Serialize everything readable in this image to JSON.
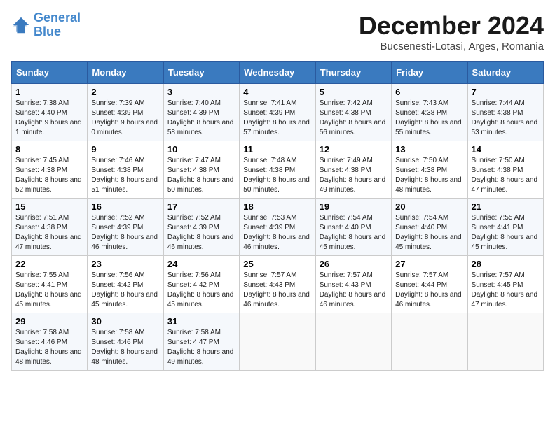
{
  "logo": {
    "text1": "General",
    "text2": "Blue"
  },
  "title": "December 2024",
  "subtitle": "Bucsenesti-Lotasi, Arges, Romania",
  "days_of_week": [
    "Sunday",
    "Monday",
    "Tuesday",
    "Wednesday",
    "Thursday",
    "Friday",
    "Saturday"
  ],
  "weeks": [
    [
      {
        "day": "1",
        "sunrise": "Sunrise: 7:38 AM",
        "sunset": "Sunset: 4:40 PM",
        "daylight": "Daylight: 9 hours and 1 minute."
      },
      {
        "day": "2",
        "sunrise": "Sunrise: 7:39 AM",
        "sunset": "Sunset: 4:39 PM",
        "daylight": "Daylight: 9 hours and 0 minutes."
      },
      {
        "day": "3",
        "sunrise": "Sunrise: 7:40 AM",
        "sunset": "Sunset: 4:39 PM",
        "daylight": "Daylight: 8 hours and 58 minutes."
      },
      {
        "day": "4",
        "sunrise": "Sunrise: 7:41 AM",
        "sunset": "Sunset: 4:39 PM",
        "daylight": "Daylight: 8 hours and 57 minutes."
      },
      {
        "day": "5",
        "sunrise": "Sunrise: 7:42 AM",
        "sunset": "Sunset: 4:38 PM",
        "daylight": "Daylight: 8 hours and 56 minutes."
      },
      {
        "day": "6",
        "sunrise": "Sunrise: 7:43 AM",
        "sunset": "Sunset: 4:38 PM",
        "daylight": "Daylight: 8 hours and 55 minutes."
      },
      {
        "day": "7",
        "sunrise": "Sunrise: 7:44 AM",
        "sunset": "Sunset: 4:38 PM",
        "daylight": "Daylight: 8 hours and 53 minutes."
      }
    ],
    [
      {
        "day": "8",
        "sunrise": "Sunrise: 7:45 AM",
        "sunset": "Sunset: 4:38 PM",
        "daylight": "Daylight: 8 hours and 52 minutes."
      },
      {
        "day": "9",
        "sunrise": "Sunrise: 7:46 AM",
        "sunset": "Sunset: 4:38 PM",
        "daylight": "Daylight: 8 hours and 51 minutes."
      },
      {
        "day": "10",
        "sunrise": "Sunrise: 7:47 AM",
        "sunset": "Sunset: 4:38 PM",
        "daylight": "Daylight: 8 hours and 50 minutes."
      },
      {
        "day": "11",
        "sunrise": "Sunrise: 7:48 AM",
        "sunset": "Sunset: 4:38 PM",
        "daylight": "Daylight: 8 hours and 50 minutes."
      },
      {
        "day": "12",
        "sunrise": "Sunrise: 7:49 AM",
        "sunset": "Sunset: 4:38 PM",
        "daylight": "Daylight: 8 hours and 49 minutes."
      },
      {
        "day": "13",
        "sunrise": "Sunrise: 7:50 AM",
        "sunset": "Sunset: 4:38 PM",
        "daylight": "Daylight: 8 hours and 48 minutes."
      },
      {
        "day": "14",
        "sunrise": "Sunrise: 7:50 AM",
        "sunset": "Sunset: 4:38 PM",
        "daylight": "Daylight: 8 hours and 47 minutes."
      }
    ],
    [
      {
        "day": "15",
        "sunrise": "Sunrise: 7:51 AM",
        "sunset": "Sunset: 4:38 PM",
        "daylight": "Daylight: 8 hours and 47 minutes."
      },
      {
        "day": "16",
        "sunrise": "Sunrise: 7:52 AM",
        "sunset": "Sunset: 4:39 PM",
        "daylight": "Daylight: 8 hours and 46 minutes."
      },
      {
        "day": "17",
        "sunrise": "Sunrise: 7:52 AM",
        "sunset": "Sunset: 4:39 PM",
        "daylight": "Daylight: 8 hours and 46 minutes."
      },
      {
        "day": "18",
        "sunrise": "Sunrise: 7:53 AM",
        "sunset": "Sunset: 4:39 PM",
        "daylight": "Daylight: 8 hours and 46 minutes."
      },
      {
        "day": "19",
        "sunrise": "Sunrise: 7:54 AM",
        "sunset": "Sunset: 4:40 PM",
        "daylight": "Daylight: 8 hours and 45 minutes."
      },
      {
        "day": "20",
        "sunrise": "Sunrise: 7:54 AM",
        "sunset": "Sunset: 4:40 PM",
        "daylight": "Daylight: 8 hours and 45 minutes."
      },
      {
        "day": "21",
        "sunrise": "Sunrise: 7:55 AM",
        "sunset": "Sunset: 4:41 PM",
        "daylight": "Daylight: 8 hours and 45 minutes."
      }
    ],
    [
      {
        "day": "22",
        "sunrise": "Sunrise: 7:55 AM",
        "sunset": "Sunset: 4:41 PM",
        "daylight": "Daylight: 8 hours and 45 minutes."
      },
      {
        "day": "23",
        "sunrise": "Sunrise: 7:56 AM",
        "sunset": "Sunset: 4:42 PM",
        "daylight": "Daylight: 8 hours and 45 minutes."
      },
      {
        "day": "24",
        "sunrise": "Sunrise: 7:56 AM",
        "sunset": "Sunset: 4:42 PM",
        "daylight": "Daylight: 8 hours and 45 minutes."
      },
      {
        "day": "25",
        "sunrise": "Sunrise: 7:57 AM",
        "sunset": "Sunset: 4:43 PM",
        "daylight": "Daylight: 8 hours and 46 minutes."
      },
      {
        "day": "26",
        "sunrise": "Sunrise: 7:57 AM",
        "sunset": "Sunset: 4:43 PM",
        "daylight": "Daylight: 8 hours and 46 minutes."
      },
      {
        "day": "27",
        "sunrise": "Sunrise: 7:57 AM",
        "sunset": "Sunset: 4:44 PM",
        "daylight": "Daylight: 8 hours and 46 minutes."
      },
      {
        "day": "28",
        "sunrise": "Sunrise: 7:57 AM",
        "sunset": "Sunset: 4:45 PM",
        "daylight": "Daylight: 8 hours and 47 minutes."
      }
    ],
    [
      {
        "day": "29",
        "sunrise": "Sunrise: 7:58 AM",
        "sunset": "Sunset: 4:46 PM",
        "daylight": "Daylight: 8 hours and 48 minutes."
      },
      {
        "day": "30",
        "sunrise": "Sunrise: 7:58 AM",
        "sunset": "Sunset: 4:46 PM",
        "daylight": "Daylight: 8 hours and 48 minutes."
      },
      {
        "day": "31",
        "sunrise": "Sunrise: 7:58 AM",
        "sunset": "Sunset: 4:47 PM",
        "daylight": "Daylight: 8 hours and 49 minutes."
      },
      null,
      null,
      null,
      null
    ]
  ]
}
